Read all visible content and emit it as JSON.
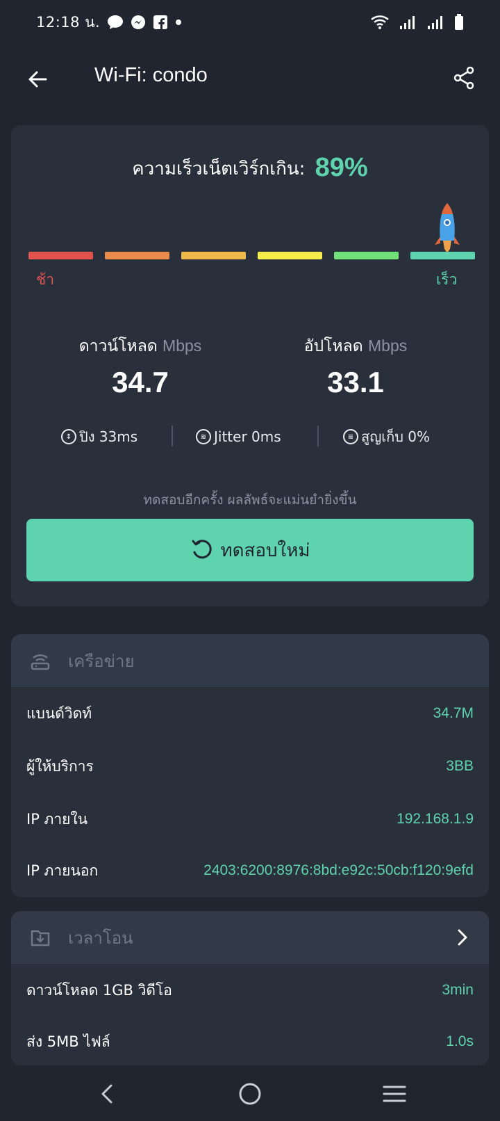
{
  "status_bar": {
    "time": "12:18 น.",
    "icons": [
      "message-bubble-icon",
      "messenger-icon",
      "facebook-icon",
      "dot-icon",
      "wifi-icon",
      "signal-icon",
      "signal-icon-2",
      "battery-icon"
    ]
  },
  "appbar": {
    "title": "Wi-Fi: condo"
  },
  "speed": {
    "headline_label": "ความเร็วเน็ตเวิร์กเกิน:",
    "headline_value": "89%",
    "meter_fraction": 0.89,
    "slow_label": "ช้า",
    "fast_label": "เร็ว",
    "meter_colors": [
      "#e0534f",
      "#e98b4a",
      "#edb94b",
      "#f6ec4c",
      "#72e07a",
      "#5fd3ad"
    ],
    "download_label": "ดาวน์โหลด",
    "download_unit": "Mbps",
    "download_value": "34.7",
    "upload_label": "อัปโหลด",
    "upload_unit": "Mbps",
    "upload_value": "33.1",
    "ping": "ปิง 33ms",
    "jitter": "Jitter 0ms",
    "loss": "สูญเก็บ 0%",
    "retest_hint": "ทดสอบอีกครั้ง ผลลัพธ์จะแม่นยำยิ่งขึ้น",
    "retest_button": "ทดสอบใหม่"
  },
  "network": {
    "header": "เครือข่าย",
    "rows": [
      {
        "key": "แบนด์วิดท์",
        "value": "34.7M"
      },
      {
        "key": "ผู้ให้บริการ",
        "value": "3BB"
      },
      {
        "key": "IP ภายใน",
        "value": "192.168.1.9"
      },
      {
        "key": "IP ภายนอก",
        "value": "2403:6200:8976:8bd:e92c:50cb:f120:9efd"
      }
    ]
  },
  "timing": {
    "header": "เวลาโอน",
    "rows": [
      {
        "key": "ดาวน์โหลด 1GB วิดีโอ",
        "value": "3min"
      },
      {
        "key": "ส่ง 5MB ไฟล์",
        "value": "1.0s"
      }
    ]
  },
  "colors": {
    "accent": "#5fd3ad",
    "background": "#20252f",
    "card": "#2a303b",
    "slow": "#e0534f"
  }
}
